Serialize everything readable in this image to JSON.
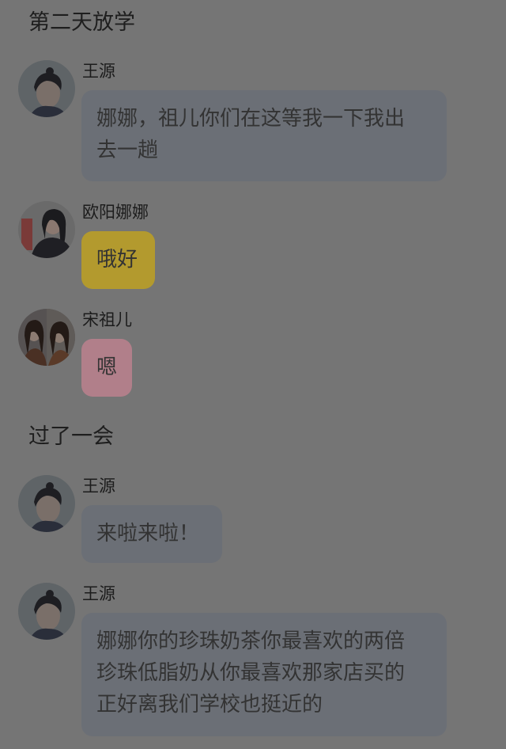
{
  "narration": {
    "day_two": "第二天放学",
    "later": "过了一会"
  },
  "messages": [
    {
      "sender": "王源",
      "lines": [
        "娜娜，祖儿你们在这等我一下我出",
        "去一趟"
      ],
      "bubble_color": "#6b6f76",
      "avatar_icon": "boy-avatar-icon"
    },
    {
      "sender": "欧阳娜娜",
      "lines": [
        "哦好"
      ],
      "bubble_color": "#b39a2e",
      "avatar_icon": "girl-avatar-icon"
    },
    {
      "sender": "宋祖儿",
      "lines": [
        "嗯"
      ],
      "bubble_color": "#b17f8a",
      "avatar_icon": "girl-avatar-icon"
    },
    {
      "sender": "王源",
      "lines": [
        "来啦来啦！"
      ],
      "bubble_color": "#6b6f76",
      "avatar_icon": "boy-avatar-icon"
    },
    {
      "sender": "王源",
      "lines": [
        "娜娜你的珍珠奶茶你最喜欢的两倍",
        "珍珠低脂奶从你最喜欢那家店买的",
        "正好离我们学校也挺近的"
      ],
      "bubble_color": "#6b6f76",
      "avatar_icon": "boy-avatar-icon"
    }
  ]
}
